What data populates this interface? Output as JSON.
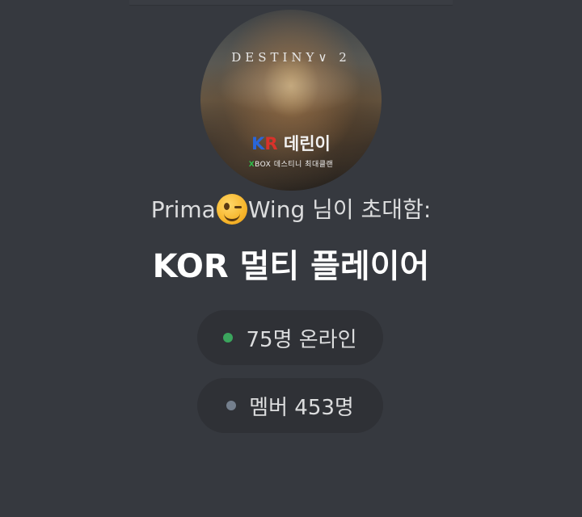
{
  "server_icon": {
    "game_title": "DESTINY∨ 2",
    "kr_k": "K",
    "kr_r": "R",
    "kr_rest": " 데린이",
    "xbox_x": "X",
    "xbox_rest": "BOX 데스티니 최대클랜"
  },
  "invite": {
    "inviter_before": "Prima",
    "inviter_after": "Wing",
    "suffix": " 님이 초대함:",
    "server_name": "KOR 멀티 플레이어"
  },
  "stats": {
    "online_label": "75명 온라인",
    "members_label": "멤버 453명"
  },
  "colors": {
    "background": "#36393f",
    "pill": "#2f3136",
    "online_dot": "#3ba55d",
    "members_dot": "#747f8d"
  },
  "icons": {
    "emoji": "winking-face-emoji",
    "online": "online-status-dot",
    "members": "members-status-dot"
  }
}
